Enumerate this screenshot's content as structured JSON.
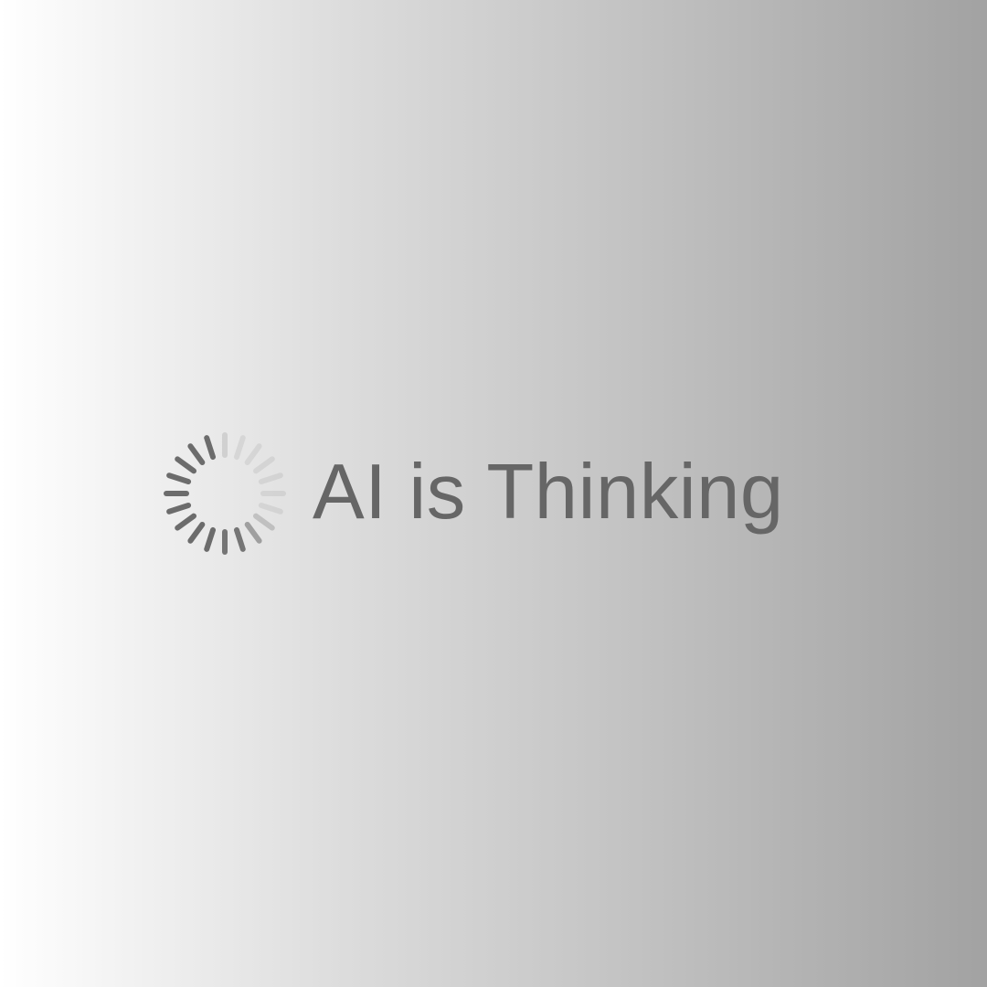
{
  "status": {
    "text": "AI is Thinking",
    "text_color": "#666666",
    "icon": "loading-spinner-icon",
    "spinner_color": "#666666"
  }
}
